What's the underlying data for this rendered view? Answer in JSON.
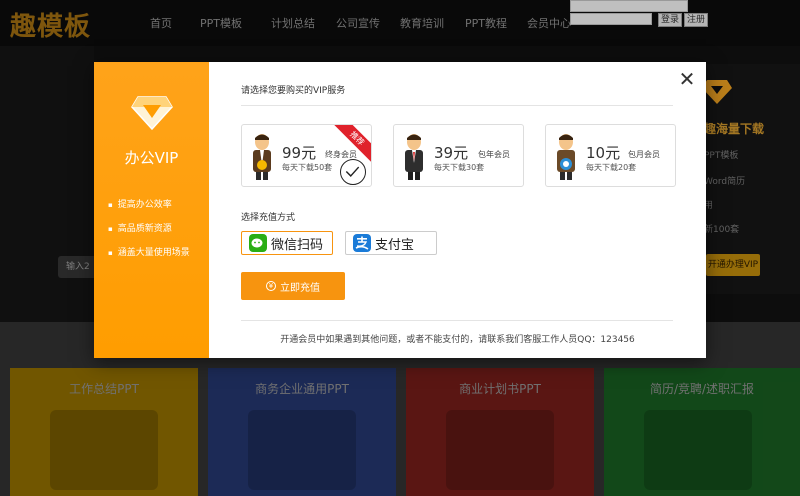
{
  "site": {
    "logo": "趣模板",
    "nav": [
      "首页",
      "PPT模板",
      "计划总结",
      "公司宣传",
      "教育培训",
      "PPT教程",
      "会员中心"
    ],
    "login": {
      "login_label": "登录",
      "register_label": "注册"
    }
  },
  "hero": {
    "input_button": "输入2",
    "promo": {
      "title": "趣海量下载",
      "items": [
        "PPT模板",
        "Word简历",
        "用",
        "新100套"
      ],
      "button": "开通办理VIP"
    }
  },
  "categories": [
    {
      "title": "工作总结PPT",
      "color": "#8a6a00"
    },
    {
      "title": "商务企业通用PPT",
      "color": "#23346a"
    },
    {
      "title": "商业计划书PPT",
      "color": "#6e1c18"
    },
    {
      "title": "简历/竞聘/述职汇报",
      "color": "#17581f"
    }
  ],
  "modal": {
    "side": {
      "title": "办公VIP",
      "features": [
        "提高办公效率",
        "高品质新资源",
        "涵盖大量使用场景"
      ]
    },
    "prompt": "请选择您要购买的VIP服务",
    "plans": [
      {
        "price": "99元",
        "kind": "终身会员",
        "quota": "每天下载50套",
        "badge": "推荐",
        "selected": true,
        "accent": "#e0222b"
      },
      {
        "price": "39元",
        "kind": "包年会员",
        "quota": "每天下载30套",
        "badge": "",
        "selected": false
      },
      {
        "price": "10元",
        "kind": "包月会员",
        "quota": "每天下载20套",
        "badge": "",
        "selected": false
      }
    ],
    "payment_label": "选择充值方式",
    "payment_methods": [
      {
        "label": "微信扫码",
        "icon": "wechat-pay-icon",
        "selected": true,
        "color": "#2aae15"
      },
      {
        "label": "支付宝",
        "icon": "alipay-icon",
        "selected": false,
        "color": "#1a7bd8"
      }
    ],
    "pay_now": {
      "label": "立即充值",
      "icon": "yen-icon"
    },
    "footer_note": "开通会员中如果遇到其他问题，或者不能支付的，请联系我们客服工作人员QQ：123456",
    "close_icon": "close-icon",
    "accent": "#f7940f"
  }
}
